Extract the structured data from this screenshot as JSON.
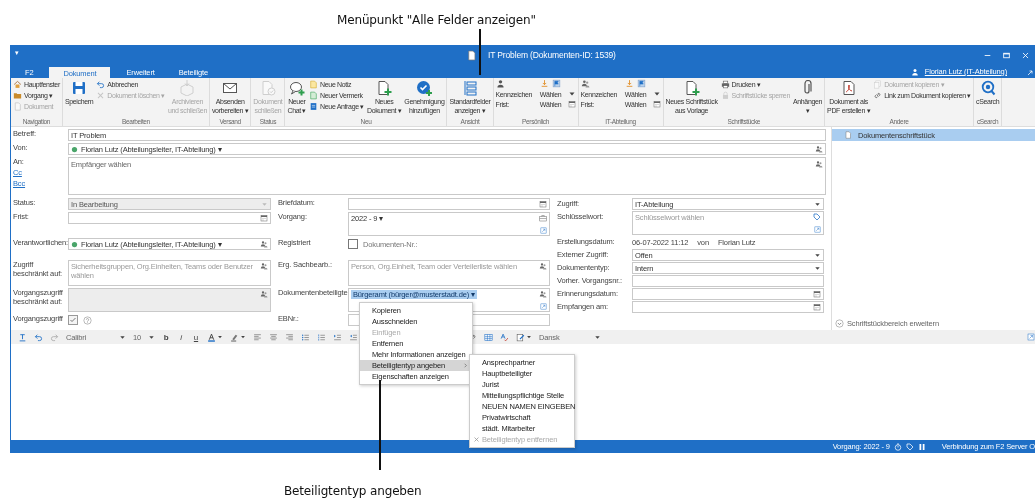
{
  "annotations": [
    {
      "kind": "top",
      "text": "Menüpunkt \"Alle Felder anzeigen\""
    },
    {
      "kind": "bottom",
      "text": "Beteiligtentyp angeben"
    }
  ],
  "window": {
    "quick_access": "▾",
    "title": "IT Problem (Dokumenten-ID: 1539)",
    "user": "Florian Lutz (IT-Abteilung)"
  },
  "tabs": [
    {
      "label": "F2",
      "selected": false
    },
    {
      "label": "Dokument",
      "selected": true
    },
    {
      "label": "Erweitert",
      "selected": false
    },
    {
      "label": "Beteiligte",
      "selected": false
    }
  ],
  "ribbon": [
    {
      "name": "Navigation",
      "items": [
        {
          "kind": "stack",
          "entries": [
            {
              "label": "Hauptfenster",
              "disabled": false
            },
            {
              "label": "Vorgang ▾",
              "disabled": false
            },
            {
              "label": "Dokument",
              "disabled": true
            }
          ]
        }
      ]
    },
    {
      "name": "Bearbeiten",
      "items": [
        {
          "kind": "large",
          "lines": [
            "Speichern"
          ],
          "disabled": false
        },
        {
          "kind": "stack",
          "entries": [
            {
              "label": "Abbrechen",
              "disabled": false
            },
            {
              "label": "Dokument löschen ▾",
              "disabled": true
            }
          ]
        },
        {
          "kind": "large",
          "lines": [
            "Archivieren",
            "und schließen"
          ],
          "disabled": true
        }
      ]
    },
    {
      "name": "Versand",
      "items": [
        {
          "kind": "large",
          "lines": [
            "Absenden",
            "vorbereiten ▾"
          ],
          "disabled": false
        }
      ]
    },
    {
      "name": "Status",
      "items": [
        {
          "kind": "large",
          "lines": [
            "Dokument",
            "schließen"
          ],
          "disabled": true
        }
      ]
    },
    {
      "name": "Neu",
      "items": [
        {
          "kind": "large",
          "lines": [
            "Neuer",
            "Chat ▾"
          ],
          "disabled": false
        },
        {
          "kind": "stack",
          "entries": [
            {
              "label": "Neue Notiz",
              "disabled": false
            },
            {
              "label": "Neuer Vermerk",
              "disabled": false
            },
            {
              "label": "Neue Anfrage ▾",
              "disabled": false
            }
          ]
        },
        {
          "kind": "large",
          "lines": [
            "Neues",
            "Dokument ▾"
          ],
          "disabled": false
        },
        {
          "kind": "large",
          "lines": [
            "Genehmigung",
            "hinzufügen"
          ],
          "disabled": false
        }
      ]
    },
    {
      "name": "Ansicht",
      "items": [
        {
          "kind": "large",
          "lines": [
            "Standardfelder",
            "anzeigen ▾"
          ],
          "disabled": false
        }
      ]
    },
    {
      "name": "Persönlich",
      "items": [
        {
          "kind": "flags",
          "rows": [
            {
              "label": "Kennzeichen",
              "value": "Wählen"
            },
            {
              "label": "Frist:",
              "value": "Wählen"
            }
          ]
        }
      ]
    },
    {
      "name": "IT-Abteilung",
      "items": [
        {
          "kind": "flags",
          "rows": [
            {
              "label": "Kennzeichen",
              "value": "Wählen"
            },
            {
              "label": "Frist:",
              "value": "Wählen"
            }
          ]
        }
      ]
    },
    {
      "name": "Schriftstücke",
      "items": [
        {
          "kind": "large",
          "lines": [
            "Neues Schriftstück",
            "aus Vorlage"
          ],
          "disabled": false
        },
        {
          "kind": "stack",
          "entries": [
            {
              "label": "Drucken ▾",
              "disabled": false
            },
            {
              "label": "Schriftstücke sperren",
              "disabled": true
            }
          ]
        },
        {
          "kind": "large",
          "lines": [
            "Anhängen",
            "▾"
          ],
          "disabled": false
        }
      ]
    },
    {
      "name": "Andere",
      "items": [
        {
          "kind": "large",
          "lines": [
            "Dokument als",
            "PDF erstellen ▾"
          ],
          "disabled": false
        },
        {
          "kind": "stack",
          "entries": [
            {
              "label": "Dokument kopieren ▾",
              "disabled": true
            },
            {
              "label": "Link zum Dokument kopieren ▾",
              "disabled": false
            }
          ]
        }
      ]
    },
    {
      "name": "cSearch",
      "items": [
        {
          "kind": "large",
          "lines": [
            "cSearch"
          ],
          "disabled": false
        }
      ]
    }
  ],
  "form": {
    "subject": {
      "label": "Betreff:",
      "value": "IT Problem"
    },
    "from": {
      "label": "Von:",
      "value": "Florian Lutz (Abteilungsleiter, IT-Abteilung) ▾"
    },
    "recipients": {
      "label": "An:",
      "links": [
        "Cc",
        "Bcc"
      ],
      "placeholder": "Empfänger wählen"
    },
    "left": [
      {
        "label": "Status:",
        "kind": "select",
        "value": "In Bearbeitung",
        "disabled": true
      },
      {
        "label": "Frist:",
        "kind": "date",
        "disabled": false
      },
      {
        "label": "Verantwortlichen:",
        "kind": "person",
        "value": "Florian Lutz (Abteilungsleiter, IT-Abteilung) ▾",
        "disabled": false
      },
      {
        "label": "Zugriff beschränkt auf:",
        "kind": "people",
        "placeholder": "Sicherheitsgruppen, Org.Einheiten, Teams oder Benutzer wählen",
        "disabled": false
      },
      {
        "label": "Vorgangszugriff beschränkt auf:",
        "kind": "people",
        "disabled": true
      },
      {
        "label": "Vorgangszugriff",
        "kind": "checkbox",
        "checked": true,
        "disabled": true
      }
    ],
    "middle": [
      {
        "label": "Briefdatum:",
        "kind": "date"
      },
      {
        "label": "Vorgang:",
        "kind": "case",
        "value": "2022 - 9 ▾"
      },
      {
        "label": "Registriert",
        "kind": "checkbox",
        "checked": false,
        "text": "Dokumenten-Nr.:"
      },
      {
        "label": "Erg. Sachbearb.:",
        "kind": "people",
        "placeholder": "Person, Org.Einheit, Team oder Verteilerliste wählen"
      },
      {
        "label": "Dokumentenbeteiligte:",
        "kind": "participants",
        "value": "Bürgeramt (bürger@musterstadt.de) ▾"
      },
      {
        "label": "EBNr.:",
        "kind": "text"
      }
    ],
    "right": [
      {
        "label": "Zugriff:",
        "kind": "select",
        "value": "IT-Abteilung"
      },
      {
        "label": "Schlüsselwort:",
        "kind": "keywords",
        "placeholder": "Schlüsselwort wählen"
      },
      {
        "label": "Erstellungsdatum:",
        "kind": "info",
        "value": "06-07-2022 11:12",
        "by_label": "von",
        "by": "Florian Lutz"
      },
      {
        "label": "Externer Zugriff:",
        "kind": "select",
        "value": "Offen"
      },
      {
        "label": "Dokumententyp:",
        "kind": "select",
        "value": "Intern"
      },
      {
        "label": "Vorher. Vorgangsnr.:",
        "kind": "text"
      },
      {
        "label": "Erinnerungsdatum:",
        "kind": "date"
      },
      {
        "label": "Empfangen am:",
        "kind": "date"
      }
    ]
  },
  "documents": {
    "items": [
      {
        "label": "Dokumentenschriftstück",
        "selected": true
      }
    ],
    "expand": "Schriftstückbereich erweitern"
  },
  "editor": {
    "font": "Calibri",
    "size": "10",
    "bold": "b",
    "italic": "i",
    "underline": "u",
    "language": "Dansk"
  },
  "context_menu": [
    {
      "label": "Kopieren",
      "disabled": false,
      "selected": false,
      "has_submenu": false
    },
    {
      "label": "Ausschneiden",
      "disabled": false,
      "selected": false,
      "has_submenu": false
    },
    {
      "label": "Einfügen",
      "disabled": true,
      "selected": false,
      "has_submenu": false
    },
    {
      "label": "Entfernen",
      "disabled": false,
      "selected": false,
      "has_submenu": false
    },
    {
      "label": "Mehr Informationen anzeigen",
      "disabled": false,
      "selected": false,
      "has_submenu": false
    },
    {
      "label": "Beteiligtentyp angeben",
      "disabled": false,
      "selected": true,
      "has_submenu": true
    },
    {
      "label": "Eigenschaften anzeigen",
      "disabled": false,
      "selected": false,
      "has_submenu": false
    }
  ],
  "submenu": [
    {
      "label": "Ansprechpartner",
      "kind": "option",
      "disabled": false
    },
    {
      "label": "Hauptbeteiligter",
      "kind": "option",
      "disabled": false
    },
    {
      "label": "Jurist",
      "kind": "option",
      "disabled": false
    },
    {
      "label": "Mitteilungspflichtige Stelle",
      "kind": "option",
      "disabled": false
    },
    {
      "label": "NEUEN NAMEN EINGEBEN",
      "kind": "option",
      "disabled": false
    },
    {
      "label": "Privatwirtschaft",
      "kind": "option",
      "disabled": false
    },
    {
      "label": "städt. Mitarbeiter",
      "kind": "option",
      "disabled": false
    },
    {
      "label": "Beteiligtentyp entfernen",
      "kind": "remove",
      "disabled": true
    }
  ],
  "status_bar": {
    "case": "Vorgang: 2022 - 9",
    "connection": "Verbindung zum F2 Server O"
  }
}
